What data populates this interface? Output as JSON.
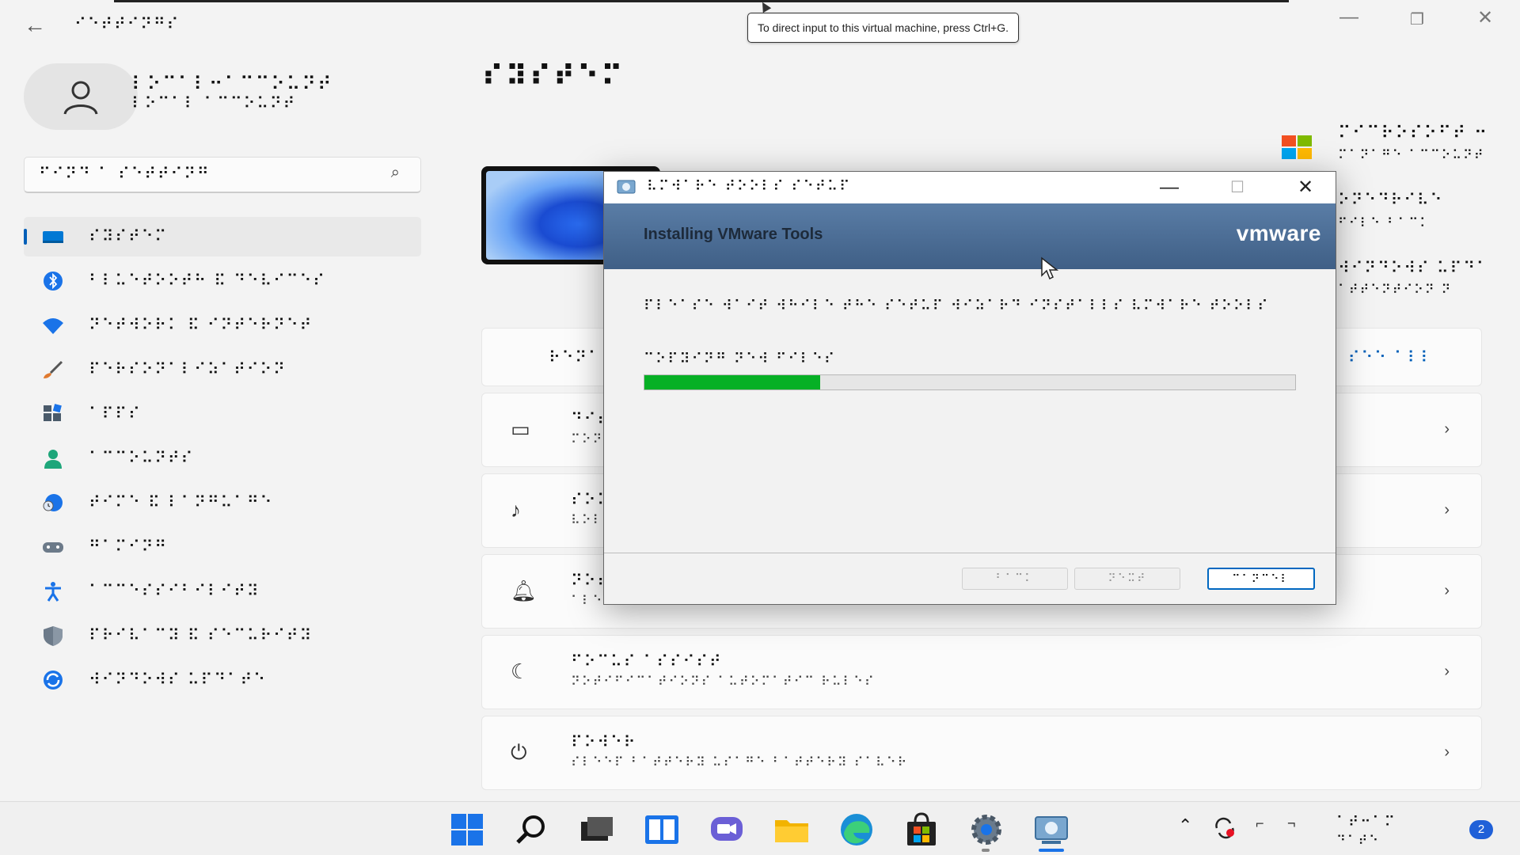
{
  "app": {
    "back_glyph": "←",
    "title": "⠊⠑⠞⠞⠊⠝⠛⠎",
    "minimize_glyph": "—",
    "restore_glyph": "❐",
    "close_glyph": "✕"
  },
  "tooltip": "To direct input to this virtual machine, press Ctrl+G.",
  "user": {
    "name": "⠇⠕⠉⠁⠇⠒⠁⠉⠉⠕⠥⠝⠞",
    "email": "⠇⠕⠉⠁⠇ ⠁⠉⠉⠕⠥⠝⠞"
  },
  "search": {
    "placeholder": "⠋⠊⠝⠙ ⠁ ⠎⠑⠞⠞⠊⠝⠛",
    "icon": "search-icon"
  },
  "nav": {
    "items": [
      {
        "label": "⠎⠽⠎⠞⠑⠍",
        "icon": "system-icon",
        "color": "#0078d4",
        "active": true
      },
      {
        "label": "⠃⠇⠥⠑⠞⠕⠕⠞⠓ ⠯ ⠙⠑⠧⠊⠉⠑⠎",
        "icon": "bluetooth-icon",
        "color": "#1a73e8",
        "active": false
      },
      {
        "label": "⠝⠑⠞⠺⠕⠗⠅ ⠯ ⠊⠝⠞⠑⠗⠝⠑⠞",
        "icon": "wifi-icon",
        "color": "#1a73e8",
        "active": false
      },
      {
        "label": "⠏⠑⠗⠎⠕⠝⠁⠇⠊⠵⠁⠞⠊⠕⠝",
        "icon": "brush-icon",
        "color": "#e07a2f",
        "active": false
      },
      {
        "label": "⠁⠏⠏⠎",
        "icon": "apps-icon",
        "color": "#4a5a6a",
        "active": false
      },
      {
        "label": "⠁⠉⠉⠕⠥⠝⠞⠎",
        "icon": "accounts-icon",
        "color": "#1ea67a",
        "active": false
      },
      {
        "label": "⠞⠊⠍⠑ ⠯ ⠇⠁⠝⠛⠥⠁⠛⠑",
        "icon": "time-language-icon",
        "color": "#1a73e8",
        "active": false
      },
      {
        "label": "⠛⠁⠍⠊⠝⠛",
        "icon": "gaming-icon",
        "color": "#6c7a89",
        "active": false
      },
      {
        "label": "⠁⠉⠉⠑⠎⠎⠊⠃⠊⠇⠊⠞⠽",
        "icon": "accessibility-icon",
        "color": "#1a73e8",
        "active": false
      },
      {
        "label": "⠏⠗⠊⠧⠁⠉⠽ ⠯ ⠎⠑⠉⠥⠗⠊⠞⠽",
        "icon": "shield-icon",
        "color": "#6c7a89",
        "active": false
      },
      {
        "label": "⠺⠊⠝⠙⠕⠺⠎ ⠥⠏⠙⠁⠞⠑",
        "icon": "windows-update-icon",
        "color": "#1a73e8",
        "active": false
      }
    ]
  },
  "main": {
    "heading": "⠎⠽⠎⠞⠑⠍",
    "right_panel": {
      "line1": "⠍⠊⠉⠗⠕⠎⠕⠋⠞ ⠒",
      "line2": "⠍⠁⠝⠁⠛⠑ ⠁⠉⠉⠕⠥⠝⠞",
      "line3": "⠕⠝⠑⠙⠗⠊⠧⠑",
      "line4": "⠋⠊⠇⠑ ⠃⠁⠉⠅",
      "line5": "⠺⠊⠝⠙⠕⠺⠎ ⠥⠏⠙⠁",
      "line6": "⠁⠞⠞⠑⠝⠞⠊⠕⠝ ⠝",
      "link": "⠎⠑⠑ ⠁⠇⠇"
    },
    "cards": [
      {
        "title": "⠙⠊⠎⠏⠇⠁⠽",
        "sub": "⠍⠕⠝⠊⠞⠕⠗⠎",
        "icon": "monitor-icon"
      },
      {
        "title": "⠎⠕⠥⠝⠙",
        "sub": "⠧⠕⠇⠥⠍⠑",
        "icon": "sound-icon"
      },
      {
        "title": "⠝⠕⠞⠊⠋⠊⠉⠁⠞⠊⠕⠝⠎",
        "sub": "⠁⠇⠑⠗⠞⠎",
        "icon": "bell-icon"
      },
      {
        "title": "⠋⠕⠉⠥⠎ ⠁⠎⠎⠊⠎⠞",
        "sub": "⠝⠕⠞⠊⠋⠊⠉⠁⠞⠊⠕⠝⠎ ⠁⠥⠞⠕⠍⠁⠞⠊⠉ ⠗⠥⠇⠑⠎",
        "icon": "moon-icon"
      },
      {
        "title": "⠏⠕⠺⠑⠗",
        "sub": "⠎⠇⠑⠑⠏ ⠃⠁⠞⠞⠑⠗⠽ ⠥⠎⠁⠛⠑ ⠃⠁⠞⠞⠑⠗⠽ ⠎⠁⠧⠑⠗",
        "icon": "power-icon"
      }
    ],
    "top_card_label": "⠗⠑⠝⠁⠍⠑"
  },
  "dialog": {
    "title": "⠧⠍⠺⠁⠗⠑ ⠞⠕⠕⠇⠎ ⠎⠑⠞⠥⠏",
    "heading": "Installing VMware Tools",
    "logo_text": "vmware",
    "description": "⠏⠇⠑⠁⠎⠑ ⠺⠁⠊⠞ ⠺⠓⠊⠇⠑ ⠞⠓⠑ ⠎⠑⠞⠥⠏ ⠺⠊⠵⠁⠗⠙ ⠊⠝⠎⠞⠁⠇⠇⠎ ⠧⠍⠺⠁⠗⠑ ⠞⠕⠕⠇⠎",
    "status": "⠉⠕⠏⠽⠊⠝⠛ ⠝⠑⠺ ⠋⠊⠇⠑⠎",
    "progress_fraction": 0.27,
    "buttons": {
      "back": "⠃⠁⠉⠅",
      "next": "⠝⠑⠭⠞",
      "cancel": "⠉⠁⠝⠉⠑⠇"
    },
    "ctl": {
      "minimize": "—",
      "maximize": "☐",
      "close": "✕"
    }
  },
  "taskbar": {
    "icons": [
      "start-icon",
      "search-icon",
      "task-view-icon",
      "widgets-icon",
      "chat-icon",
      "file-explorer-icon",
      "edge-icon",
      "store-icon",
      "settings-icon",
      "vmware-setup-icon"
    ],
    "clock": "⠁⠞⠒⠁⠍",
    "date": "⠙⠁⠞⠑",
    "notifications": "2"
  }
}
